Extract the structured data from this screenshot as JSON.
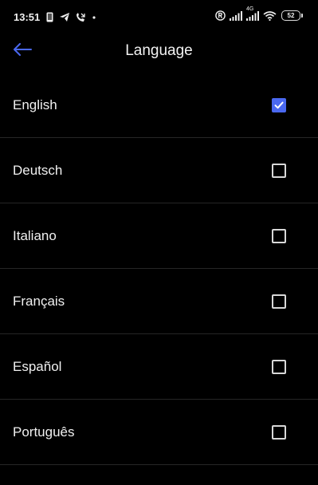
{
  "status_bar": {
    "time": "13:51",
    "network_type": "4G",
    "battery_level": "52",
    "icons": [
      "phone-icon",
      "telegram-icon",
      "missed-call-icon",
      "dot-icon",
      "registered-icon",
      "signal-icon",
      "signal-4g-icon",
      "wifi-icon",
      "battery-icon"
    ]
  },
  "header": {
    "title": "Language",
    "back_icon": "arrow-left-icon"
  },
  "accent_color": "#4a68f0",
  "languages": [
    {
      "label": "English",
      "selected": true
    },
    {
      "label": "Deutsch",
      "selected": false
    },
    {
      "label": "Italiano",
      "selected": false
    },
    {
      "label": "Français",
      "selected": false
    },
    {
      "label": "Español",
      "selected": false
    },
    {
      "label": "Português",
      "selected": false
    }
  ]
}
